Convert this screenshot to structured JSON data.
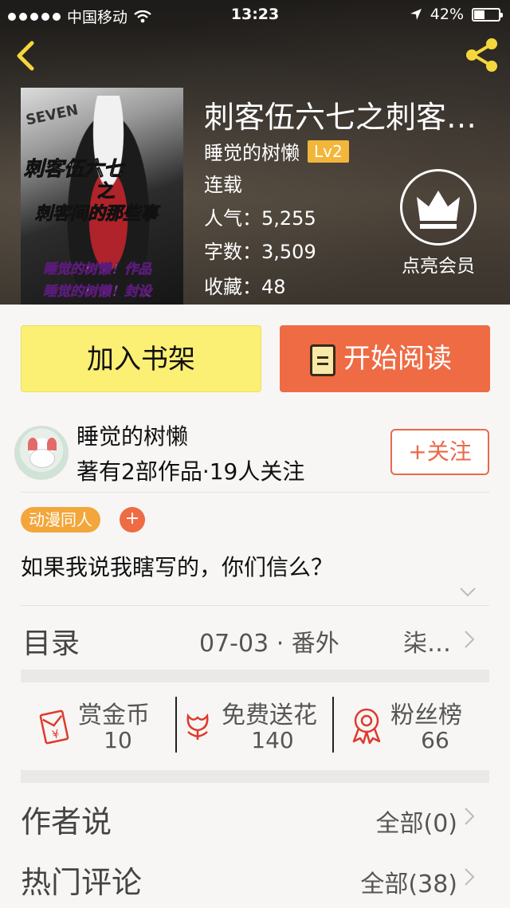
{
  "status_bar": {
    "carrier": "中国移动",
    "time": "13:23",
    "battery": "42%",
    "battery_level": 0.42
  },
  "book": {
    "title": "刺客伍六七之刺客…",
    "author": "睡觉的树懒",
    "level": "Lv2",
    "status": "连载",
    "popularity_label": "人气：",
    "popularity": "5,255",
    "words_label": "字数：",
    "words": "3,509",
    "favorites_label": "收藏：",
    "favorites": "48",
    "cover_title_1": "刺客伍六七",
    "cover_title_2": "之",
    "cover_title_3": "刺客间的那些事",
    "cover_credit_1": "睡觉的树懒！作品",
    "cover_credit_2": "睡觉的树懒！封设",
    "cover_top_text": "SEVEN"
  },
  "vip": {
    "label": "点亮会员"
  },
  "actions": {
    "add_shelf": "加入书架",
    "start_reading": "开始阅读"
  },
  "author_card": {
    "name": "睡觉的树懒",
    "stats": "著有2部作品·19人关注",
    "follow": "+关注"
  },
  "tags": {
    "items": [
      "动漫同人"
    ],
    "add": "+"
  },
  "description": "如果我说我瞎写的，你们信么？",
  "toc": {
    "label": "目录",
    "latest": "07-03 · 番外",
    "latest_title": "柒…"
  },
  "stats": [
    {
      "label": "赏金币",
      "value": "10",
      "icon": "red-envelope-icon"
    },
    {
      "label": "免费送花",
      "value": "140",
      "icon": "flower-icon"
    },
    {
      "label": "粉丝榜",
      "value": "66",
      "icon": "medal-icon"
    }
  ],
  "author_says": {
    "label": "作者说",
    "value": "全部(0)"
  },
  "hot_comments": {
    "label": "热门评论",
    "value": "全部(38)"
  },
  "colors": {
    "accent_orange": "#ee6b44",
    "shelf_yellow": "#fbef74",
    "level_badge": "#f2b63a",
    "icon_red": "#e03a2c"
  }
}
